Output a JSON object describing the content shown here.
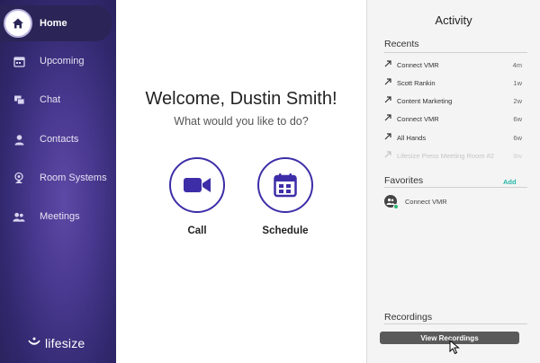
{
  "sidebar": {
    "items": [
      {
        "label": "Home",
        "icon": "home-icon",
        "active": true
      },
      {
        "label": "Upcoming",
        "icon": "calendar-icon"
      },
      {
        "label": "Chat",
        "icon": "chat-icon"
      },
      {
        "label": "Contacts",
        "icon": "contact-icon"
      },
      {
        "label": "Room Systems",
        "icon": "room-system-icon"
      },
      {
        "label": "Meetings",
        "icon": "meetings-icon"
      }
    ],
    "logo_text": "lifesize"
  },
  "main": {
    "welcome": "Welcome, Dustin Smith!",
    "subtitle": "What would you like to do?",
    "actions": [
      {
        "label": "Call",
        "icon": "video-camera-icon"
      },
      {
        "label": "Schedule",
        "icon": "calendar-icon"
      }
    ]
  },
  "activity": {
    "title": "Activity",
    "recents_title": "Recents",
    "recents": [
      {
        "name": "Connect VMR",
        "time": "4m"
      },
      {
        "name": "Scott Rankin",
        "time": "1w"
      },
      {
        "name": "Content Marketing",
        "time": "2w"
      },
      {
        "name": "Connect VMR",
        "time": "6w"
      },
      {
        "name": "All Hands",
        "time": "6w"
      },
      {
        "name": "Lifesize Press Meeting Room #2",
        "time": "8w"
      }
    ],
    "favorites_title": "Favorites",
    "favorites_add": "Add",
    "favorites": [
      {
        "name": "Connect VMR",
        "status": "online"
      }
    ],
    "recordings_title": "Recordings",
    "view_recordings": "View Recordings"
  },
  "colors": {
    "accent": "#3d2ea8",
    "sidebar": "#48388e",
    "add_link": "#25b6a8",
    "online": "#2bb673"
  }
}
